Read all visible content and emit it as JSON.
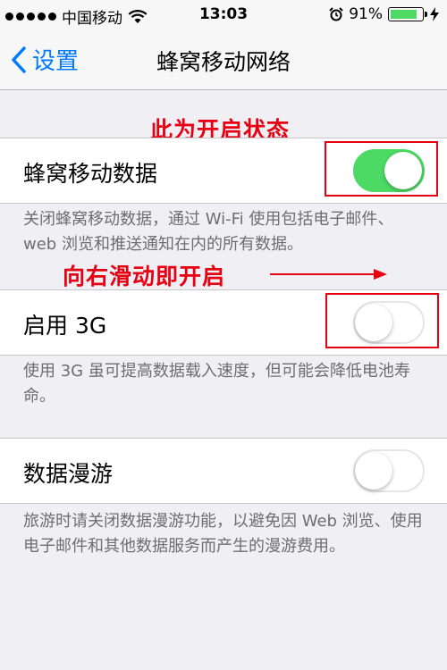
{
  "status_bar": {
    "carrier": "中国移动",
    "time": "13:03",
    "battery_percent": "91%",
    "battery_level": 0.91,
    "signal_bars": 5
  },
  "nav": {
    "back_label": "设置",
    "title": "蜂窝移动网络"
  },
  "annotations": {
    "on_state": "此为开启状态",
    "swipe_right": "向右滑动即开启"
  },
  "cellular_data": {
    "label": "蜂窝移动数据",
    "enabled": true,
    "footnote": "关闭蜂窝移动数据，通过 Wi-Fi 使用包括电子邮件、web 浏览和推送通知在内的所有数据。"
  },
  "enable_3g": {
    "label": "启用 3G",
    "enabled": false,
    "footnote": "使用 3G 虽可提高数据载入速度，但可能会降低电池寿命。"
  },
  "data_roaming": {
    "label": "数据漫游",
    "enabled": false,
    "footnote": "旅游时请关闭数据漫游功能，以避免因 Web 浏览、使用电子邮件和其他数据服务而产生的漫游费用。"
  },
  "colors": {
    "ios_blue": "#007aff",
    "toggle_on": "#4cd964",
    "annotation_red": "#e60012"
  }
}
